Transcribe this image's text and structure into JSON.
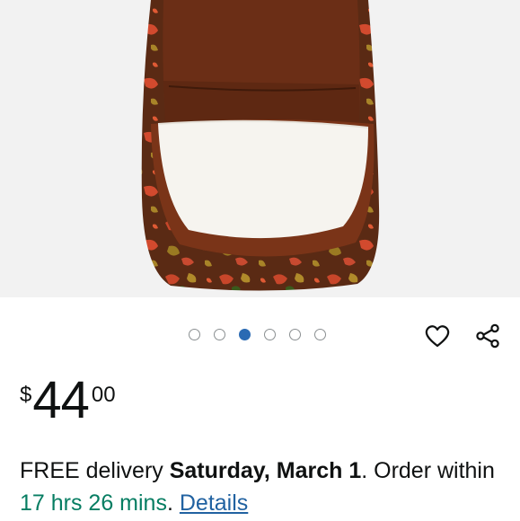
{
  "product": {
    "image_alt": "Backpack with open front pocket, red and olive camouflage pattern",
    "carousel": {
      "count": 6,
      "active_index": 2
    }
  },
  "actions": {
    "wishlist_icon": "heart-outline-icon",
    "share_icon": "share-icon"
  },
  "price": {
    "symbol": "$",
    "whole": "44",
    "fraction": "00"
  },
  "delivery": {
    "prefix": "FREE delivery ",
    "date": "Saturday, March 1",
    "mid": ". Order within ",
    "countdown": "17 hrs 26 mins",
    "suffix": ". ",
    "details_link": "Details"
  },
  "colors": {
    "countdown": "#067d62",
    "link": "#2162a1",
    "active_dot": "#2a6ab3"
  }
}
